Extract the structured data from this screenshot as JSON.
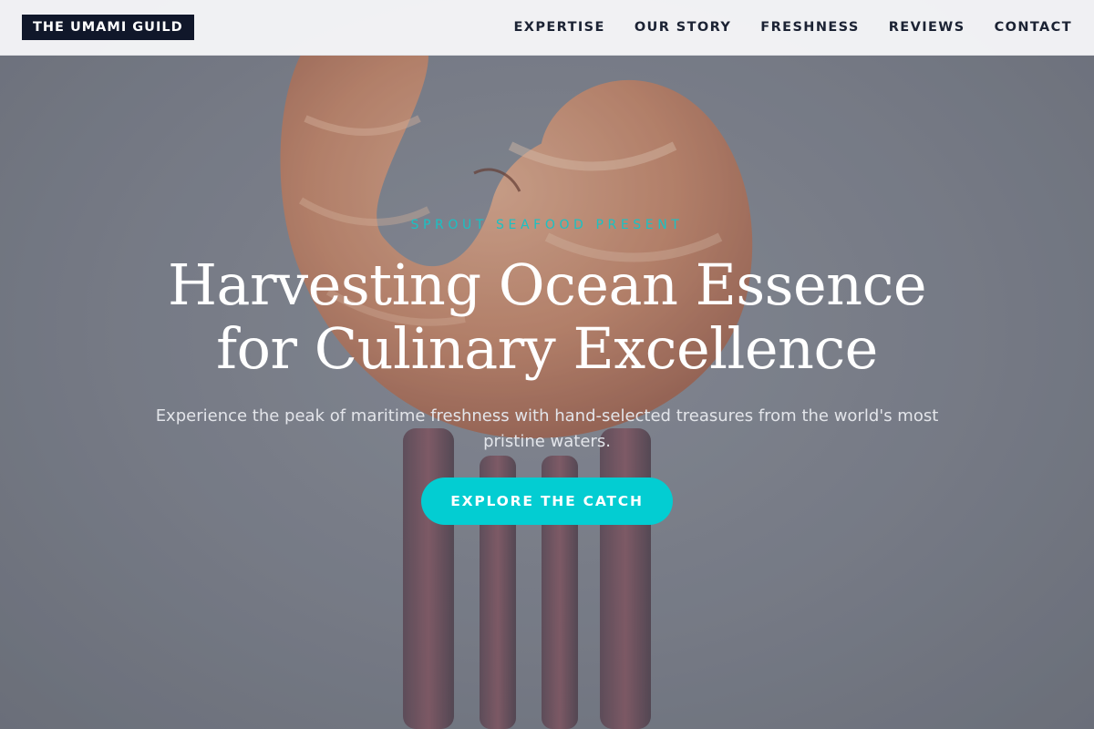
{
  "brand": {
    "name": "THE UMAMI GUILD"
  },
  "nav": {
    "items": [
      {
        "label": "EXPERTISE"
      },
      {
        "label": "OUR STORY"
      },
      {
        "label": "FRESHNESS"
      },
      {
        "label": "REVIEWS"
      },
      {
        "label": "CONTACT"
      }
    ]
  },
  "hero": {
    "eyebrow": "SPROUT SEAFOOD PRESENT",
    "headline_line1": "Harvesting Ocean Essence",
    "headline_line2": "for Culinary Excellence",
    "subtitle": "Experience the peak of maritime freshness with hand-selected treasures from the world's most pristine waters.",
    "cta_label": "EXPLORE THE CATCH",
    "image_description_icon": "shrimp-on-fork-photo"
  },
  "colors": {
    "accent": "#03cdd2",
    "eyebrow": "#19c2c4",
    "logo_bg": "#10172a",
    "nav_text": "#1b2233",
    "header_bg": "#f6f6f8"
  }
}
